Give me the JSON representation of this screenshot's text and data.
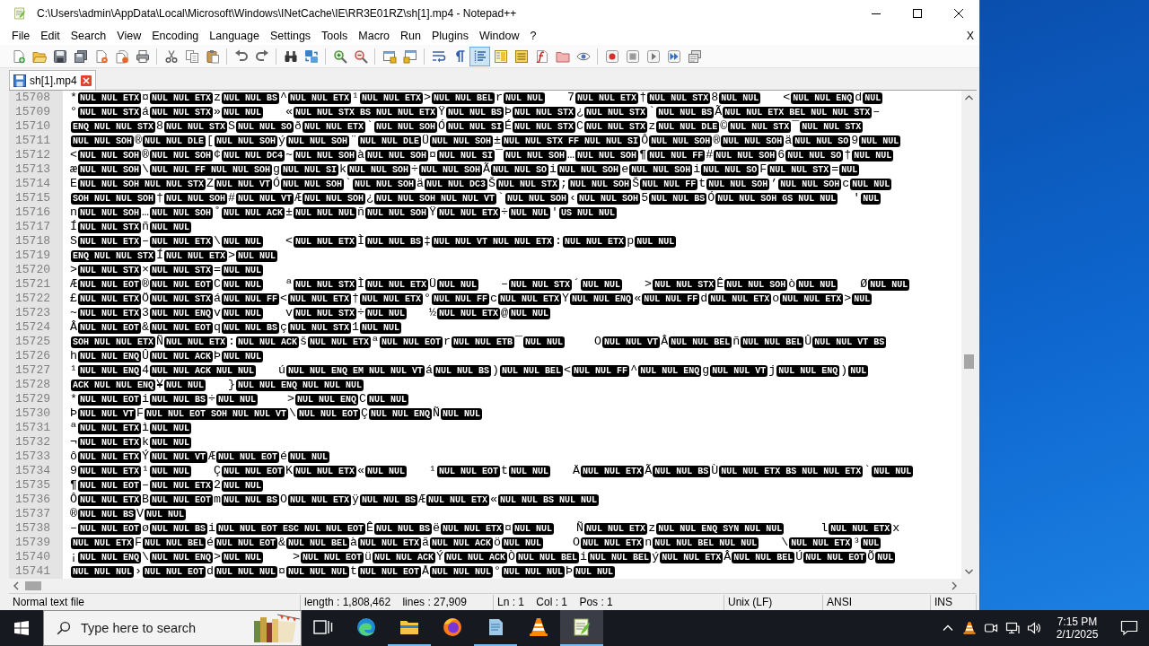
{
  "window": {
    "title": "C:\\Users\\admin\\AppData\\Local\\Microsoft\\Windows\\INetCache\\IE\\RR3E01RZ\\sh[1].mp4 - Notepad++"
  },
  "menu": {
    "items": [
      "File",
      "Edit",
      "Search",
      "View",
      "Encoding",
      "Language",
      "Settings",
      "Tools",
      "Macro",
      "Run",
      "Plugins",
      "Window",
      "?"
    ],
    "close": "X"
  },
  "toolbar": {
    "groups": [
      [
        {
          "pressed": false
        },
        {
          "pressed": false
        },
        {
          "pressed": false
        },
        {
          "pressed": false
        },
        {
          "pressed": false
        },
        {
          "pressed": false
        },
        {
          "pressed": false
        }
      ],
      [
        {
          "pressed": false
        },
        {
          "pressed": false
        },
        {
          "pressed": false
        }
      ],
      [
        {
          "pressed": false
        },
        {
          "pressed": false
        }
      ],
      [
        {
          "pressed": false
        },
        {
          "pressed": false
        }
      ],
      [
        {
          "pressed": false
        },
        {
          "pressed": false
        }
      ],
      [
        {
          "pressed": false
        },
        {
          "pressed": false
        }
      ],
      [
        {
          "pressed": false
        },
        {
          "pressed": false
        },
        {
          "pressed": true
        },
        {
          "pressed": false
        },
        {
          "pressed": false
        },
        {
          "pressed": false
        },
        {
          "pressed": false
        },
        {
          "pressed": false
        }
      ],
      [
        {
          "pressed": false
        },
        {
          "pressed": false
        },
        {
          "pressed": false
        },
        {
          "pressed": false
        },
        {
          "pressed": false
        }
      ]
    ]
  },
  "tabs": [
    {
      "label": "sh[1].mp4",
      "selected": true
    }
  ],
  "editor": {
    "lines": [
      {
        "number": "15708",
        "kind": "text",
        "segments": [
          "*",
          "NUL NUL ETX",
          "¤",
          "NUL NUL ETX",
          "z",
          "NUL NUL BS",
          "^",
          "NUL NUL ETX",
          "¹",
          "NUL NUL ETX",
          ">",
          "NUL NUL BEL",
          "r",
          "NUL NUL",
          "   7",
          "NUL NUL ETX",
          "†",
          "NUL NUL STX",
          "8",
          "NUL NUL",
          "   <",
          "NUL NUL ENQ",
          "d",
          "NUL"
        ]
      },
      {
        "number": "15709",
        "kind": "text",
        "segments": [
          "°",
          "NUL NUL STX",
          "á",
          "NUL NUL STX",
          "»",
          "NUL NUL",
          "   «",
          "NUL NUL STX BS NUL NUL ETX",
          "Ÿ",
          "NUL NUL BS",
          "Þ",
          "NUL NUL STX",
          "¿",
          "NUL NUL STX",
          "`",
          "NUL NUL BS",
          "Ã",
          "NUL NUL ETX BEL NUL NUL STX",
          "–"
        ]
      },
      {
        "number": "15710",
        "kind": "control",
        "segments": [
          "ENQ NUL NUL STX",
          "8",
          "NUL NUL STX",
          "S",
          "NUL NUL SO",
          "ð",
          "NUL NUL ETX",
          "`",
          "NUL NUL SOH",
          "Ó",
          "NUL NUL SI",
          "É",
          "NUL NUL STX",
          "C",
          "NUL NUL STX",
          "z",
          "NUL NUL DLE",
          "©",
          "NUL NUL STX",
          "¯",
          "NUL NUL STX"
        ]
      },
      {
        "number": "15711",
        "kind": "control",
        "segments": [
          "NUL NUL SOH",
          "®",
          "NUL NUL DLE",
          "[",
          "NUL NUL SOH",
          "ý",
          "NUL NUL SOH",
          "¨",
          "NUL NUL DLE",
          "Ü",
          "NUL NUL SOH",
          "±",
          "NUL NUL STX FF NUL NUL SI",
          "Ô",
          "NUL NUL SOH",
          "®",
          "NUL NUL SOH",
          "ä",
          "NUL NUL SO",
          "9",
          "NUL NUL"
        ]
      },
      {
        "number": "15712",
        "kind": "text",
        "segments": [
          "<",
          "NUL NUL SOH",
          "®",
          "NUL NUL SOH",
          "¢",
          "NUL NUL DC4",
          "~",
          "NUL NUL SOH",
          "à",
          "NUL NUL SOH",
          "¤",
          "NUL NUL SI",
          "¯",
          "NUL NUL SOH",
          "…",
          "NUL NUL SOH",
          "¶",
          "NUL NUL FF",
          "#",
          "NUL NUL SOH",
          "6",
          "NUL NUL SO",
          "†",
          "NUL NUL"
        ]
      },
      {
        "number": "15713",
        "kind": "text",
        "segments": [
          "æ",
          "NUL NUL SOH",
          "\\",
          "NUL NUL FF NUL NUL SOH",
          "g",
          "NUL NUL SI",
          "k",
          "NUL NUL SOH",
          "÷",
          "NUL NUL SOH",
          "Ã",
          "NUL NUL SO",
          "i",
          "NUL NUL SOH",
          "e",
          "NUL NUL SOH",
          "i",
          "NUL NUL SO",
          "F",
          "NUL NUL STX",
          "=",
          "NUL"
        ]
      },
      {
        "number": "15714",
        "kind": "text",
        "segments": [
          "E",
          "NUL NUL SOH NUL NUL STX",
          "Z",
          "NUL NUL VT",
          "Ó",
          "NUL NUL SOH",
          "`",
          "NUL NUL SOH",
          "ä",
          "NUL NUL DC3",
          "Š",
          "NUL NUL STX",
          ";",
          "NUL NUL SOH",
          "Š",
          "NUL NUL FF",
          "t",
          "NUL NUL SOH",
          "’",
          "NUL NUL SOH",
          "c",
          "NUL NUL"
        ]
      },
      {
        "number": "15715",
        "kind": "control",
        "segments": [
          "SOH NUL NUL SOH",
          "†",
          "NUL NUL SOH",
          "#",
          "NUL NUL VT",
          "Æ",
          "NUL NUL SOH",
          "¿",
          "NUL NUL SOH NUL NUL VT",
          "`",
          "NUL NUL SOH",
          "‹",
          "NUL NUL SOH",
          "5",
          "NUL NUL BS",
          "Ó",
          "NUL NUL SOH GS NUL NUL",
          "  '",
          "NUL"
        ]
      },
      {
        "number": "15716",
        "kind": "text",
        "segments": [
          "n",
          "NUL NUL SOH",
          "…",
          "NUL NUL SOH",
          "˚",
          "NUL NUL ACK",
          "±",
          "NUL NUL NUL",
          "ñ",
          "NUL NUL SOH",
          "Ÿ",
          "NUL NUL ETX",
          "÷",
          "NUL NUL",
          "'",
          "US NUL NUL"
        ]
      },
      {
        "number": "15717",
        "kind": "text",
        "segments": [
          "Í",
          "NUL NUL STX",
          "ñ",
          "NUL NUL"
        ]
      },
      {
        "number": "15718",
        "kind": "text",
        "segments": [
          "S",
          "NUL NUL ETX",
          "–",
          "NUL NUL ETX",
          "\\",
          "NUL NUL",
          "   <",
          "NUL NUL ETX",
          "Ì",
          "NUL NUL BS",
          "‡",
          "NUL NUL VT NUL NUL ETX",
          ":",
          "NUL NUL ETX",
          "p",
          "NUL NUL"
        ]
      },
      {
        "number": "15719",
        "kind": "control",
        "segments": [
          "ENQ NUL NUL STX",
          "Í",
          "NUL NUL ETX",
          ">",
          "NUL NUL"
        ]
      },
      {
        "number": "15720",
        "kind": "text",
        "segments": [
          ">",
          "NUL NUL STX",
          "×",
          "NUL NUL STX",
          "=",
          "NUL NUL"
        ]
      },
      {
        "number": "15721",
        "kind": "text",
        "segments": [
          "Æ",
          "NUL NUL EOT",
          "®",
          "NUL NUL EOT",
          "C",
          "NUL NUL",
          "   ª",
          "NUL NUL STX",
          "Ì",
          "NUL NUL ETX",
          "Ü",
          "NUL NUL",
          "   –",
          "NUL NUL STX",
          "´",
          "NUL NUL",
          "   >",
          "NUL NUL STX",
          "Ê",
          "NUL NUL SOH",
          "ò",
          "NUL NUL",
          "   Ø",
          "NUL NUL"
        ]
      },
      {
        "number": "15722",
        "kind": "text",
        "segments": [
          "£",
          "NUL NUL ETX",
          "Ö",
          "NUL NUL STX",
          "á",
          "NUL NUL FF",
          "<",
          "NUL NUL ETX",
          "†",
          "NUL NUL ETX",
          "°",
          "NUL NUL FF",
          "c",
          "NUL NUL ETX",
          "Y",
          "NUL NUL ENQ",
          "«",
          "NUL NUL FF",
          "d",
          "NUL NUL ETX",
          "o",
          "NUL NUL ETX",
          ">",
          "NUL"
        ]
      },
      {
        "number": "15723",
        "kind": "text",
        "segments": [
          "~",
          "NUL NUL ETX",
          "3",
          "NUL NUL ENQ",
          "v",
          "NUL NUL",
          "   v",
          "NUL NUL STX",
          "÷",
          "NUL NUL",
          "   ½",
          "NUL NUL ETX",
          "@",
          "NUL NUL"
        ]
      },
      {
        "number": "15724",
        "kind": "text",
        "segments": [
          "Â",
          "NUL NUL EOT",
          "&",
          "NUL NUL EOT",
          "q",
          "NUL NUL BS",
          "ç",
          "NUL NUL STX",
          "1",
          "NUL NUL"
        ]
      },
      {
        "number": "15725",
        "kind": "control",
        "segments": [
          "SOH NUL NUL ETX",
          "Ñ",
          "NUL NUL ETX",
          ":",
          "NUL NUL ACK",
          "š",
          "NUL NUL ETX",
          "ª",
          "NUL NUL EOT",
          "r",
          "NUL NUL ETB",
          "¯",
          "NUL NUL",
          "    O",
          "NUL NUL VT",
          "Â",
          "NUL NUL BEL",
          "ñ",
          "NUL NUL BEL",
          "Û",
          "NUL NUL VT BS"
        ]
      },
      {
        "number": "15726",
        "kind": "text",
        "segments": [
          "h",
          "NUL NUL ENQ",
          "Û",
          "NUL NUL ACK",
          "Þ",
          "NUL NUL"
        ]
      },
      {
        "number": "15727",
        "kind": "text",
        "segments": [
          "¹",
          "NUL NUL ENQ",
          "4",
          "NUL NUL ACK NUL NUL",
          "   ú",
          "NUL NUL ENQ EM NUL NUL VT",
          "á",
          "NUL NUL BS",
          ")",
          "NUL NUL BEL",
          "<",
          "NUL NUL FF",
          "^",
          "NUL NUL ENQ",
          "g",
          "NUL NUL VT",
          "j",
          "NUL NUL ENQ",
          ")",
          "NUL"
        ]
      },
      {
        "number": "15728",
        "kind": "control",
        "segments": [
          "ACK NUL NUL ENQ",
          "¥",
          "NUL NUL",
          "   }",
          "NUL NUL ENQ NUL NUL NUL"
        ]
      },
      {
        "number": "15729",
        "kind": "text",
        "segments": [
          "*",
          "NUL NUL EOT",
          "i",
          "NUL NUL BS",
          "÷",
          "NUL NUL",
          "    >",
          "NUL NUL ENQ",
          "C",
          "NUL NUL"
        ]
      },
      {
        "number": "15730",
        "kind": "text",
        "segments": [
          "Þ",
          "NUL NUL VT",
          "F",
          "NUL NUL EOT SOH NUL NUL VT",
          "\\",
          "NUL NUL EOT",
          "Ç",
          "NUL NUL ENQ",
          "Ñ",
          "NUL NUL"
        ]
      },
      {
        "number": "15731",
        "kind": "text",
        "segments": [
          "ª",
          "NUL NUL ETX",
          "ì",
          "NUL NUL"
        ]
      },
      {
        "number": "15732",
        "kind": "text",
        "segments": [
          "¬",
          "NUL NUL ETX",
          "k",
          "NUL NUL"
        ]
      },
      {
        "number": "15733",
        "kind": "text",
        "segments": [
          "ô",
          "NUL NUL ETX",
          "Ý",
          "NUL NUL VT",
          "Æ",
          "NUL NUL EOT",
          "é",
          "NUL NUL"
        ]
      },
      {
        "number": "15734",
        "kind": "text",
        "segments": [
          "9",
          "NUL NUL ETX",
          "¹",
          "NUL NUL",
          "   Ç",
          "NUL NUL EOT",
          "K",
          "NUL NUL ETX",
          "«",
          "NUL NUL",
          "   ¹",
          "NUL NUL EOT",
          "t",
          "NUL NUL",
          "   Ä",
          "NUL NUL ETX",
          "Ã",
          "NUL NUL BS",
          "Ù",
          "NUL NUL ETX BS NUL NUL ETX",
          "`",
          "NUL NUL"
        ]
      },
      {
        "number": "15735",
        "kind": "text",
        "segments": [
          "¶",
          "NUL NUL EOT",
          "–",
          "NUL NUL ETX",
          "2",
          "NUL NUL"
        ]
      },
      {
        "number": "15736",
        "kind": "text",
        "segments": [
          "Ô",
          "NUL NUL ETX",
          "B",
          "NUL NUL EOT",
          "m",
          "NUL NUL BS",
          "O",
          "NUL NUL ETX",
          "ÿ",
          "NUL NUL BS",
          "Æ",
          "NUL NUL ETX",
          "«",
          "NUL NUL BS NUL NUL"
        ]
      },
      {
        "number": "15737",
        "kind": "text",
        "segments": [
          "®",
          "NUL NUL BS",
          "V",
          "NUL NUL"
        ]
      },
      {
        "number": "15738",
        "kind": "text",
        "segments": [
          "–",
          "NUL NUL EOT",
          "ø",
          "NUL NUL BS",
          "i",
          "NUL NUL EOT ESC NUL NUL EOT",
          "Ê",
          "NUL NUL BS",
          "ë",
          "NUL NUL ETX",
          "¤",
          "NUL NUL",
          "   Ñ",
          "NUL NUL ETX",
          "z",
          "NUL NUL ENQ SYN NUL NUL",
          "     l",
          "NUL NUL ETX",
          "x"
        ]
      },
      {
        "number": "15739",
        "kind": "control",
        "segments": [
          "NUL NUL ETX",
          "F",
          "NUL NUL BEL",
          "é",
          "NUL NUL EOT",
          "&",
          "NUL NUL BEL",
          "à",
          "NUL NUL ETX",
          "ã",
          "NUL NUL ACK",
          "ö",
          "NUL NUL",
          "    O",
          "NUL NUL ETX",
          "n",
          "NUL NUL BEL NUL NUL",
          "   \\",
          "NUL NUL ETX",
          "³",
          "NUL"
        ]
      },
      {
        "number": "15740",
        "kind": "text",
        "segments": [
          "¡",
          "NUL NUL ENQ",
          "\\",
          "NUL NUL ENQ",
          ">",
          "NUL NUL",
          "    >",
          "NUL NUL EOT",
          "ü",
          "NUL NUL ACK",
          "Ý",
          "NUL NUL ACK",
          "Ò",
          "NUL NUL BEL",
          "i",
          "NUL NUL BEL",
          "ý",
          "NUL NUL ETX",
          "Â",
          "NUL NUL BEL",
          "Ú",
          "NUL NUL EOT",
          "Õ",
          "NUL"
        ]
      },
      {
        "number": "15741",
        "kind": "control",
        "segments": [
          "NUL NUL NUL",
          "›",
          "NUL NUL EOT",
          "d",
          "NUL NUL NUL",
          "¤",
          "NUL NUL NUL",
          "t",
          "NUL NUL EOT",
          "Å",
          "NUL NUL NUL",
          "°",
          "NUL NUL NUL",
          "Þ",
          "NUL NUL"
        ]
      }
    ]
  },
  "status_bar": [
    "Normal text file",
    "length : 1,808,462    lines : 27,909",
    "Ln : 1    Col : 1    Pos : 1",
    "Unix (LF)",
    "ANSI",
    "INS"
  ],
  "taskbar": {
    "search": {
      "placeholder": "Type here to search"
    },
    "apps": [
      {
        "running": false,
        "active": false
      },
      {
        "running": true,
        "active": false
      },
      {
        "running": false,
        "active": false
      },
      {
        "running": true,
        "active": false
      },
      {
        "running": false,
        "active": false
      },
      {
        "running": true,
        "active": true
      }
    ],
    "clock": {
      "time": "7:15 PM",
      "date": "2/1/2025"
    }
  }
}
